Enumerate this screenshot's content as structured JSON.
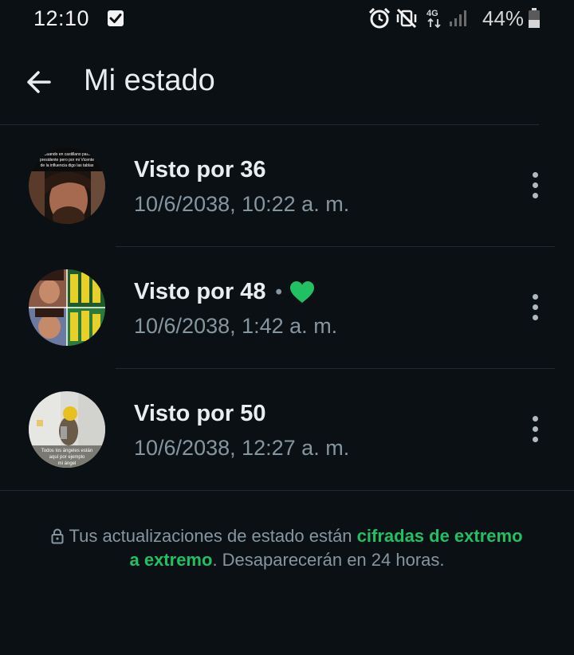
{
  "status_bar": {
    "time": "12:10",
    "network": "4G",
    "battery": "44%"
  },
  "header": {
    "title": "Mi estado"
  },
  "statuses": [
    {
      "views": "Visto por 36",
      "timestamp": "10/6/2038, 10:22 a. m.",
      "liked": false,
      "thumbnail_text": "Cuando en castillano para presidente pero por mi Vicente de la influencia digo las tablas de multiplicar"
    },
    {
      "views": "Visto por 48",
      "timestamp": "10/6/2038, 1:42 a. m.",
      "liked": true,
      "separator": "•"
    },
    {
      "views": "Visto por 50",
      "timestamp": "10/6/2038, 12:27 a. m.",
      "liked": false,
      "thumbnail_text": "Todos los ángeles están aquí por ejemplo mi ángel"
    }
  ],
  "footer": {
    "text_before": "Tus actualizaciones de estado están ",
    "link_text": "cifradas de extremo a extremo",
    "text_after": ". Desaparecerán en 24 horas."
  },
  "colors": {
    "background": "#0b1014",
    "accent": "#21c063",
    "secondary_text": "#8696a0"
  },
  "icons": {
    "back": "arrow-left-icon",
    "more": "more-vertical-icon",
    "heart": "heart-icon",
    "lock": "lock-icon"
  }
}
